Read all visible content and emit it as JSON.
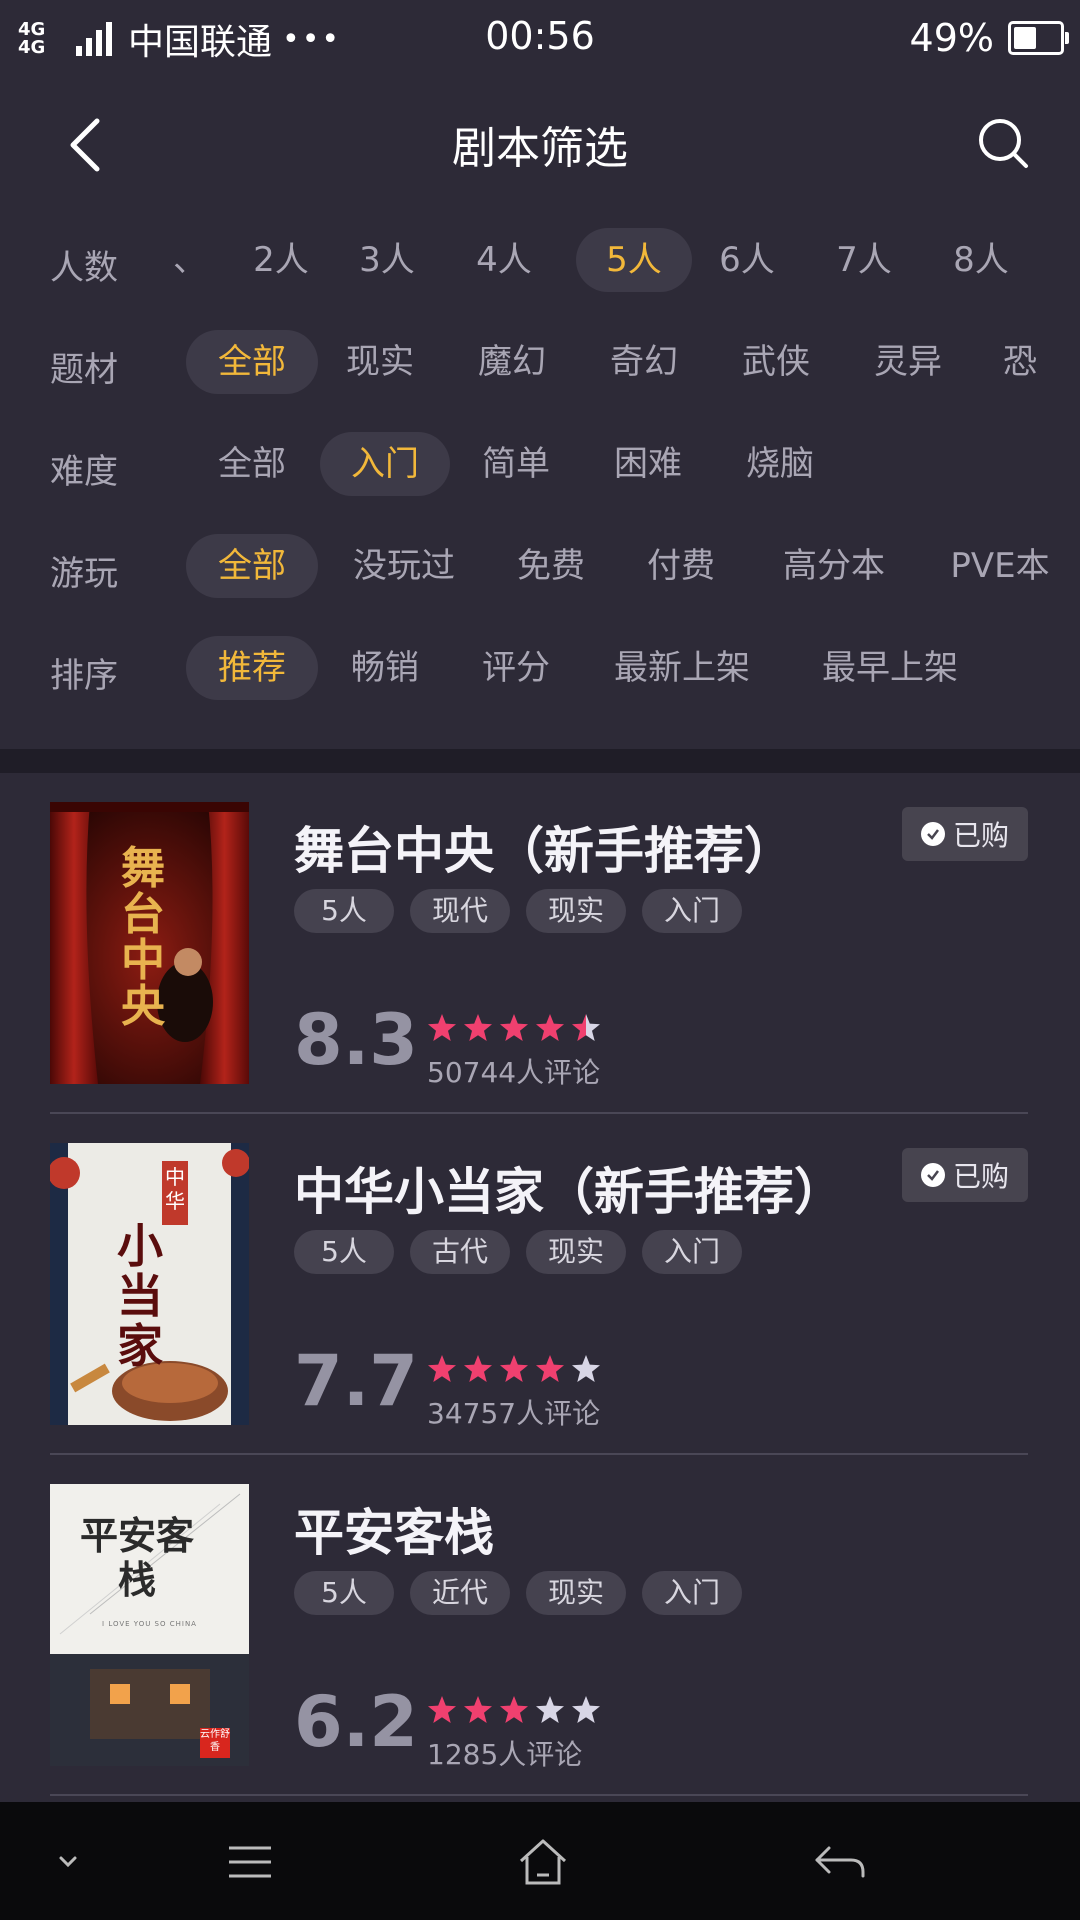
{
  "status_bar": {
    "network_top": "4G",
    "network_bottom": "4G",
    "carrier": "中国联通",
    "more": "•••",
    "time": "00:56",
    "battery_percent": "49%",
    "battery_level": 0.49
  },
  "header": {
    "title": "剧本筛选",
    "back_icon": "chevron-left-icon",
    "search_icon": "search-icon"
  },
  "filters": [
    {
      "label": "人数",
      "options": [
        "、",
        "2人",
        "3人",
        "4人",
        "5人",
        "6人",
        "7人",
        "8人"
      ],
      "selected": "5人"
    },
    {
      "label": "题材",
      "options": [
        "全部",
        "现实",
        "魔幻",
        "奇幻",
        "武侠",
        "灵异",
        "恐"
      ],
      "selected": "全部"
    },
    {
      "label": "难度",
      "options": [
        "全部",
        "入门",
        "简单",
        "困难",
        "烧脑"
      ],
      "selected": "入门"
    },
    {
      "label": "游玩",
      "options": [
        "全部",
        "没玩过",
        "免费",
        "付费",
        "高分本",
        "PVE本"
      ],
      "selected": "全部"
    },
    {
      "label": "排序",
      "options": [
        "推荐",
        "畅销",
        "评分",
        "最新上架",
        "最早上架"
      ],
      "selected": "推荐"
    }
  ],
  "purchased_label": "已购",
  "scripts": [
    {
      "title": "舞台中央（新手推荐）",
      "purchased": true,
      "tags": [
        "5人",
        "现代",
        "现实",
        "入门"
      ],
      "score": "8.3",
      "stars": 4.5,
      "reviews": "50744人评论",
      "cover_text": "舞台中央"
    },
    {
      "title": "中华小当家（新手推荐）",
      "purchased": true,
      "tags": [
        "5人",
        "古代",
        "现实",
        "入门"
      ],
      "score": "7.7",
      "stars": 4,
      "reviews": "34757人评论",
      "cover_text_small": "中华",
      "cover_text": "小当家"
    },
    {
      "title": "平安客栈",
      "purchased": false,
      "tags": [
        "5人",
        "近代",
        "现实",
        "入门"
      ],
      "score": "6.2",
      "stars": 3,
      "reviews": "1285人评论",
      "cover_text": "平安客栈",
      "cover_subtext": "I LOVE YOU SO CHINA",
      "cover_seal": "云作舒香"
    }
  ],
  "colors": {
    "background": "#2d2a37",
    "accent": "#f2b83a",
    "star_on": "#f0406f",
    "star_off": "#d8d6e6"
  },
  "system_nav": [
    "chevron-down-icon",
    "menu-icon",
    "home-icon",
    "back-arrow-icon"
  ]
}
